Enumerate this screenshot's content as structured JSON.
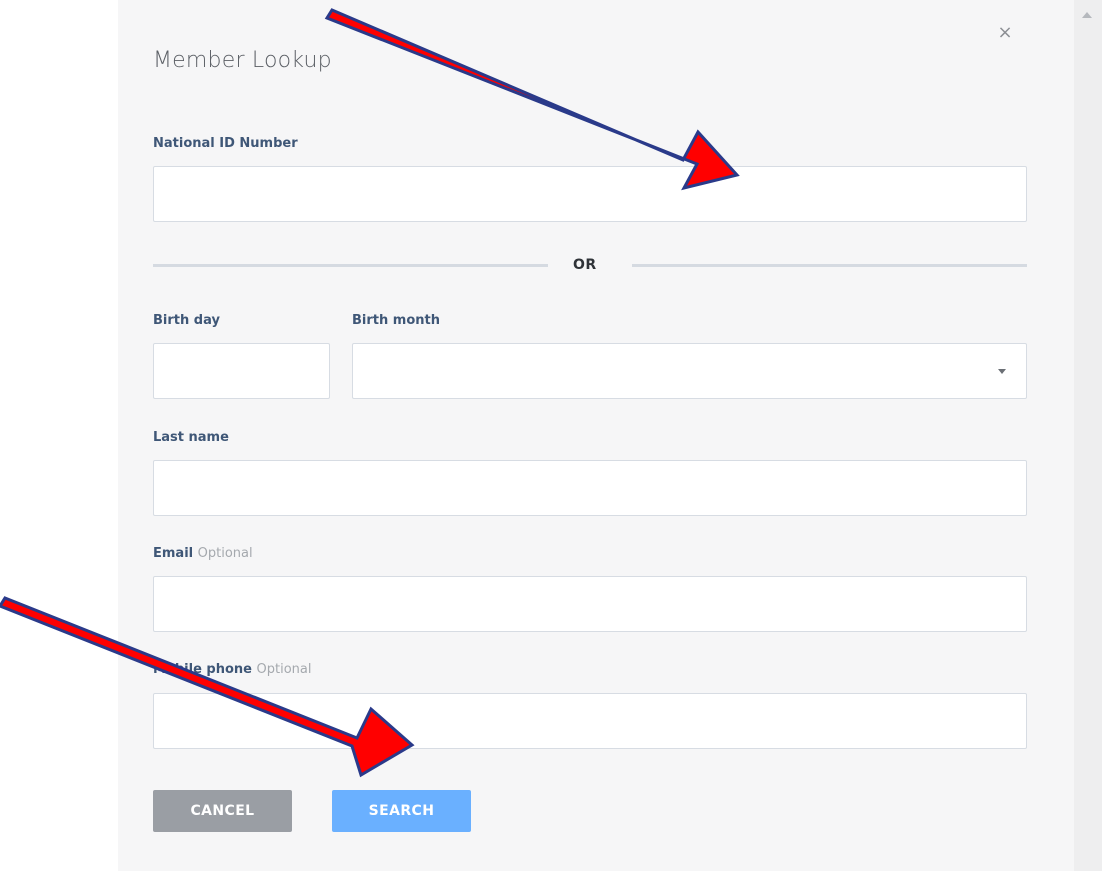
{
  "modal": {
    "title": "Member Lookup",
    "close_glyph": "×"
  },
  "form": {
    "national_id": {
      "label": "National ID Number",
      "value": "",
      "placeholder": ""
    },
    "separator": "OR",
    "birth_day": {
      "label": "Birth day",
      "value": ""
    },
    "birth_month": {
      "label": "Birth month",
      "selected": ""
    },
    "last_name": {
      "label": "Last name",
      "value": ""
    },
    "email": {
      "label": "Email",
      "optional": "Optional",
      "value": ""
    },
    "mobile_phone": {
      "label": "Mobile phone",
      "optional": "Optional",
      "value": ""
    }
  },
  "actions": {
    "cancel_label": "CANCEL",
    "search_label": "SEARCH"
  },
  "colors": {
    "label": "#3f5777",
    "cancel_button": "#9a9ea4",
    "search_button": "#6ab0ff",
    "annotation_arrow": "#ff0000",
    "annotation_outline": "#2a3a8a"
  },
  "icons": {
    "close": "close-icon",
    "dropdown": "chevron-down-icon",
    "scroll_up": "scroll-up-icon"
  }
}
